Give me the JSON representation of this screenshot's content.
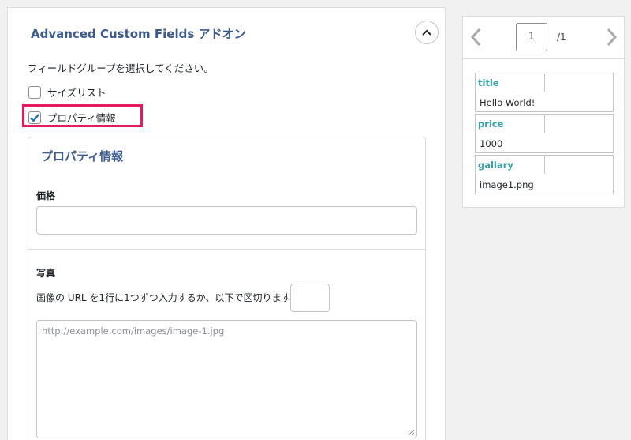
{
  "panel": {
    "title": "Advanced Custom Fields アドオン",
    "prompt": "フィールドグループを選択してください。",
    "options": [
      {
        "label": "サイズリスト",
        "checked": false
      },
      {
        "label": "プロパティ情報",
        "checked": true
      }
    ],
    "highlight_color": "#e5195c"
  },
  "group": {
    "title": "プロパティ情報",
    "price_label": "価格",
    "price_value": "",
    "photo_label": "写真",
    "photo_help": "画像の URL を1行に1つずつ入力するか、以下で区切ります:",
    "separator_value": "",
    "url_placeholder": "http://example.com/images/image-1.jpg"
  },
  "preview": {
    "page_current": "1",
    "page_total": "/1",
    "cards": [
      {
        "key": "title",
        "value": "Hello World!"
      },
      {
        "key": "price",
        "value": "1000"
      },
      {
        "key": "gallary",
        "value": "image1.png"
      }
    ]
  }
}
